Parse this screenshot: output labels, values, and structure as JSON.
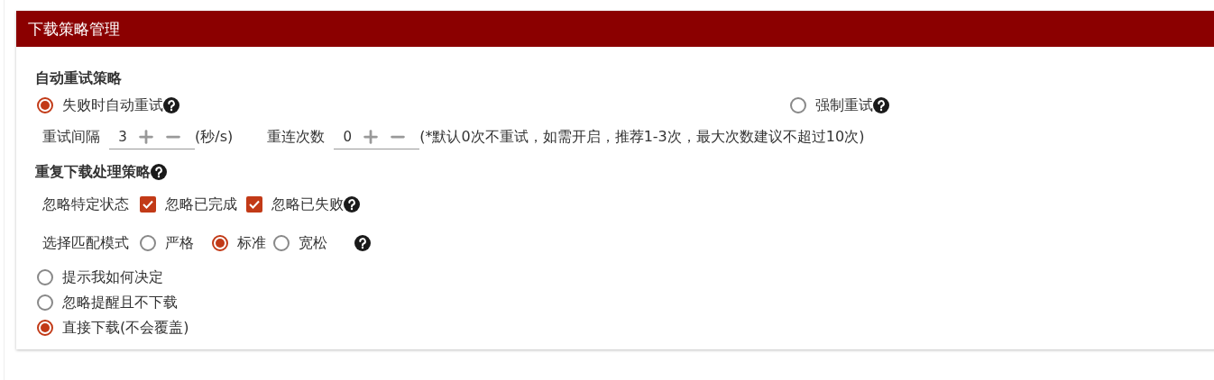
{
  "panel": {
    "title": "下载策略管理"
  },
  "retry": {
    "heading": "自动重试策略",
    "modes": [
      {
        "label": "失败时自动重试",
        "selected": true,
        "help": true
      },
      {
        "label": "强制重试",
        "selected": false,
        "help": true
      }
    ],
    "steppers": [
      {
        "label": "重试间隔",
        "value": "3",
        "suffix": "(秒/s)"
      },
      {
        "label": "重连次数",
        "value": "0",
        "suffix": "(*默认0次不重试，如需开启，推荐1-3次，最大次数建议不超过10次)"
      }
    ]
  },
  "duplicate": {
    "heading": "重复下载处理策略",
    "help": true,
    "status": {
      "label": "忽略特定状态",
      "options": [
        {
          "label": "忽略已完成",
          "checked": true,
          "help": false
        },
        {
          "label": "忽略已失败",
          "checked": true,
          "help": true
        }
      ]
    },
    "match": {
      "label": "选择匹配模式",
      "help": true,
      "options": [
        {
          "label": "严格",
          "selected": false
        },
        {
          "label": "标准",
          "selected": true
        },
        {
          "label": "宽松",
          "selected": false
        }
      ]
    },
    "actions": [
      {
        "label": "提示我如何决定",
        "selected": false
      },
      {
        "label": "忽略提醒且不下载",
        "selected": false
      },
      {
        "label": "直接下载(不会覆盖)",
        "selected": true
      }
    ]
  }
}
